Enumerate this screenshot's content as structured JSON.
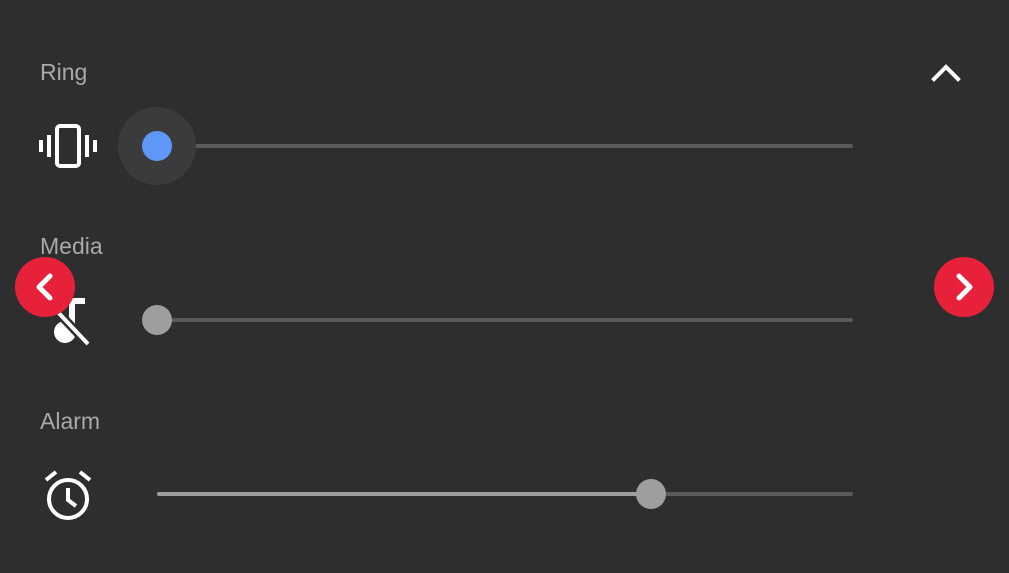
{
  "volume_panel": {
    "streams": [
      {
        "label": "Ring",
        "icon": "vibrate-icon",
        "level": 0,
        "active": true
      },
      {
        "label": "Media",
        "icon": "music-off-icon",
        "level": 0,
        "active": false
      },
      {
        "label": "Alarm",
        "icon": "alarm-clock-icon",
        "level": 0.71,
        "active": false
      }
    ],
    "collapse_icon": "chevron-up-icon"
  },
  "navigation": {
    "prev_icon": "chevron-left-icon",
    "next_icon": "chevron-right-icon"
  },
  "colors": {
    "background": "#2e2e2e",
    "active_thumb": "#5e97f6",
    "nav_button": "#e8213a",
    "label_text": "#a9a9a9"
  }
}
